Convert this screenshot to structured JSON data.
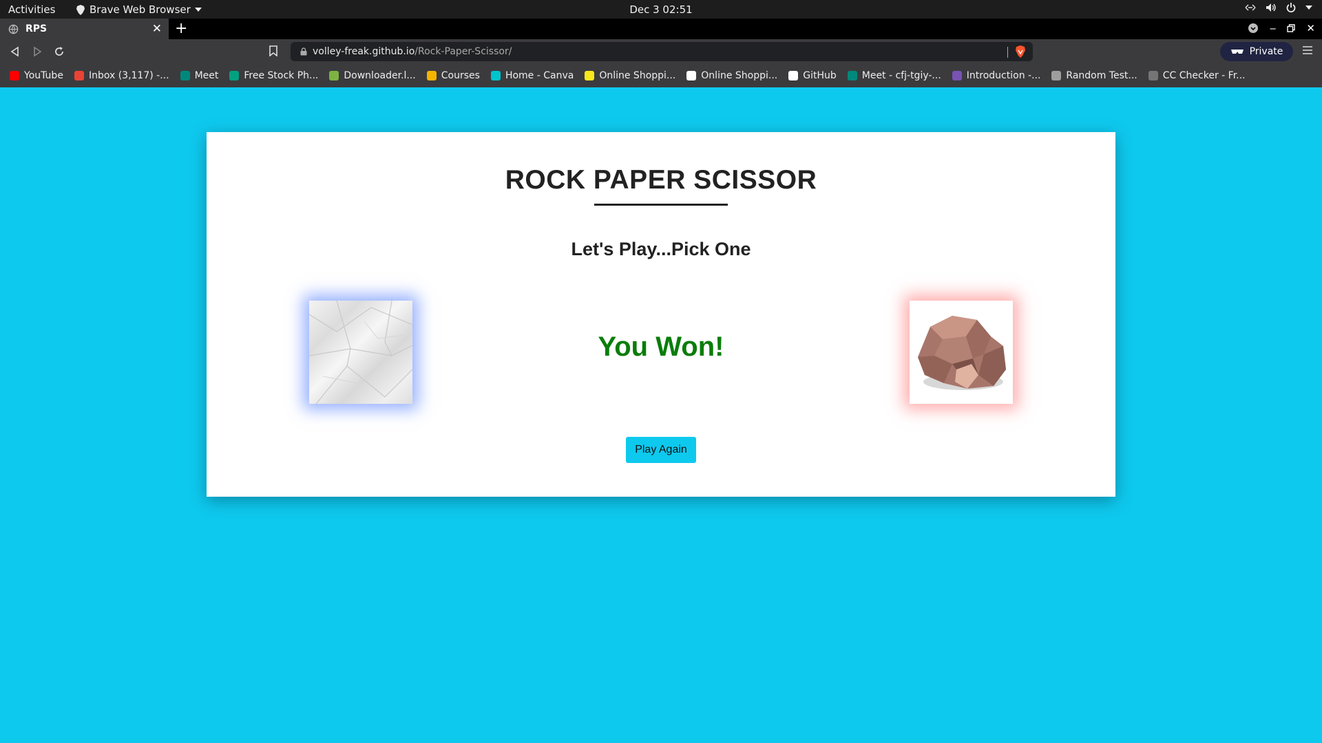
{
  "system_bar": {
    "activities": "Activities",
    "app_name": "Brave Web Browser",
    "clock": "Dec 3  02:51"
  },
  "browser": {
    "tab_title": "RPS",
    "url_host": "volley-freak.github.io",
    "url_path": "/Rock-Paper-Scissor/",
    "private_label": "Private",
    "bookmarks": [
      {
        "label": "YouTube",
        "color": "#ff0000"
      },
      {
        "label": "Inbox (3,117) -...",
        "color": "#ea4335"
      },
      {
        "label": "Meet",
        "color": "#00897b"
      },
      {
        "label": "Free Stock Ph...",
        "color": "#05a081"
      },
      {
        "label": "Downloader.l...",
        "color": "#7cb342"
      },
      {
        "label": "Courses",
        "color": "#f4b400"
      },
      {
        "label": "Home - Canva",
        "color": "#00c4cc"
      },
      {
        "label": "Online Shoppi...",
        "color": "#f8e71c"
      },
      {
        "label": "Online Shoppi...",
        "color": "#ffffff"
      },
      {
        "label": "GitHub",
        "color": "#ffffff"
      },
      {
        "label": "Meet - cfj-tgiy-...",
        "color": "#00897b"
      },
      {
        "label": "Introduction -...",
        "color": "#7952b3"
      },
      {
        "label": "Random Test...",
        "color": "#9e9e9e"
      },
      {
        "label": "CC Checker - Fr...",
        "color": "#757575"
      }
    ]
  },
  "game": {
    "title": "ROCK PAPER SCISSOR",
    "subtitle": "Let's Play...Pick One",
    "player_choice": "paper",
    "computer_choice": "rock",
    "result": "You Won!",
    "result_color": "#0a7d0a",
    "play_again_label": "Play Again",
    "accent_color": "#0ec9ee"
  }
}
